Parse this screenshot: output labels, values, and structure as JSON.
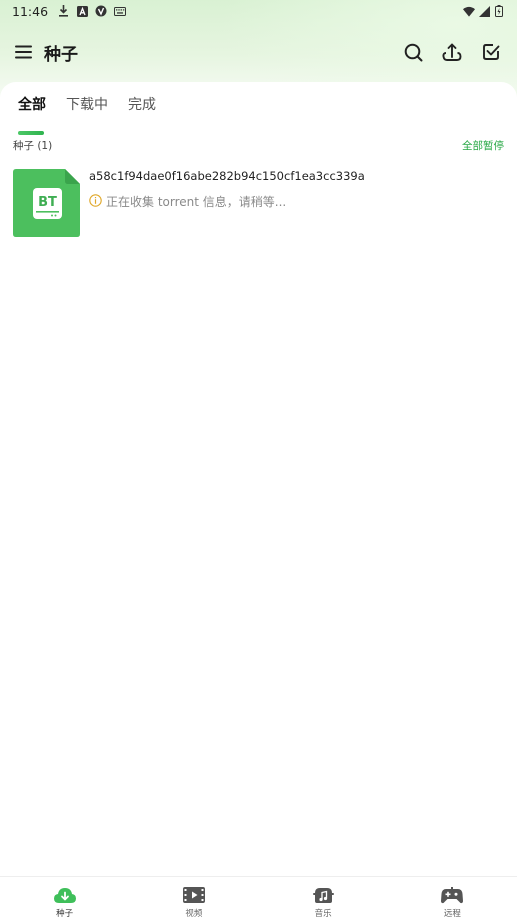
{
  "status_bar": {
    "time": "11:46",
    "left_icons": [
      "download-icon",
      "notification-a-icon",
      "vpn-icon",
      "keyboard-icon"
    ],
    "right_icons": [
      "wifi-icon",
      "signal-icon",
      "battery-icon"
    ]
  },
  "app_bar": {
    "title": "种子",
    "actions": [
      "search-icon",
      "upload-icon",
      "select-icon"
    ]
  },
  "tabs": [
    {
      "label": "全部",
      "active": true
    },
    {
      "label": "下载中",
      "active": false
    },
    {
      "label": "完成",
      "active": false
    }
  ],
  "section": {
    "label": "种子 (1)",
    "pause_all": "全部暂停"
  },
  "torrents": [
    {
      "icon_text": "BT",
      "name": "a58c1f94dae0f16abe282b94c150cf1ea3cc339a",
      "status": "正在收集 torrent 信息，请稍等..."
    }
  ],
  "bottom_nav": [
    {
      "label": "种子",
      "icon": "cloud-download-icon",
      "active": true
    },
    {
      "label": "视频",
      "icon": "video-icon",
      "active": false
    },
    {
      "label": "音乐",
      "icon": "music-icon",
      "active": false
    },
    {
      "label": "远程",
      "icon": "gamepad-icon",
      "active": false
    }
  ],
  "colors": {
    "accent": "#2fb34f",
    "bt_icon": "#4cbf5e"
  }
}
